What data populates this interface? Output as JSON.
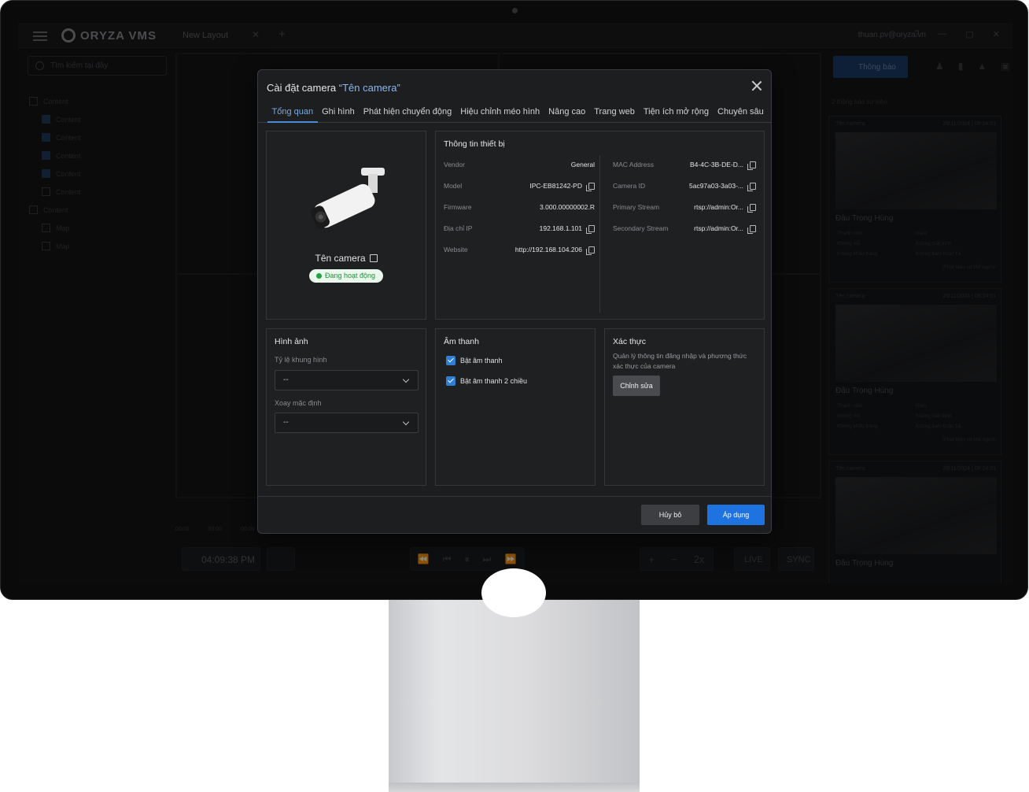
{
  "app": {
    "logo_text": "ORYZA VMS",
    "layout_tab": "New Layout",
    "user_email": "thuan.pv@oryza.vn",
    "search_placeholder": "Tìm kiếm tại đây",
    "tree": [
      {
        "label": "Content",
        "level": 0
      },
      {
        "label": "Content",
        "level": 1,
        "checked": true
      },
      {
        "label": "Content",
        "level": 1,
        "checked": true
      },
      {
        "label": "Content",
        "level": 1,
        "checked": true
      },
      {
        "label": "Content",
        "level": 1,
        "checked": true
      },
      {
        "label": "Content",
        "level": 1,
        "checked": false
      },
      {
        "label": "Content",
        "level": 0
      },
      {
        "label": "Map",
        "level": 1,
        "checked": false
      },
      {
        "label": "Map",
        "level": 1,
        "checked": false
      }
    ],
    "notifications": {
      "button": "Thông báo",
      "event_count": "2 thông báo sự kiện",
      "cards": [
        {
          "camera": "Tên camera",
          "time": "28/11/2024 | 08:24:01",
          "person": "Đậu Trọng Hùng",
          "attrs": [
            "Thanh niên",
            "Nam",
            "Không mũ",
            "Không mắt kính",
            "Không khẩu trang",
            "Không balo hoặc túi"
          ],
          "footer": "Phát hiện cơ thể người"
        },
        {
          "camera": "Tên camera",
          "time": "28/11/2024 | 08:24:01",
          "person": "Đậu Trọng Hùng",
          "attrs": [
            "Thanh niên",
            "Nam",
            "Không mũ",
            "Không mắt kính",
            "Không khẩu trang",
            "Không balo hoặc túi"
          ],
          "footer": "Phát hiện cơ thể người"
        },
        {
          "camera": "Tên camera",
          "time": "28/11/2024 | 08:24:01",
          "person": "Đậu Trọng Hùng",
          "attrs": [],
          "footer": ""
        }
      ]
    },
    "timeline": {
      "clock": "04:09:38 PM",
      "ruler": [
        "00:00",
        "00:00",
        "00:00"
      ],
      "live": "LIVE",
      "sync": "SYNC",
      "speed": "2x"
    }
  },
  "dialog": {
    "title_prefix": "Cài đặt camera ",
    "title_highlight": "“Tên camera”",
    "tabs": [
      "Tổng quan",
      "Ghi hình",
      "Phát hiện chuyển động",
      "Hiệu chỉnh méo hình",
      "Nâng cao",
      "Trang web",
      "Tiện ích mở rộng",
      "Chuyên sâu"
    ],
    "active_tab": 0,
    "camera_name": "Tên camera",
    "status": "Đang hoạt động",
    "info_title": "Thông tin thiết bị",
    "info_left": [
      {
        "label": "Vendor",
        "value": "General",
        "copy": false
      },
      {
        "label": "Model",
        "value": "IPC-EB81242-PD",
        "copy": true
      },
      {
        "label": "Firmware",
        "value": "3.000.00000002.R",
        "copy": false
      },
      {
        "label": "Địa chỉ IP",
        "value": "192.168.1.101",
        "copy": true
      },
      {
        "label": "Website",
        "value": "http://192.168.104.206",
        "copy": true
      }
    ],
    "info_right": [
      {
        "label": "MAC Address",
        "value": "B4-4C-3B-DE-D...",
        "copy": true
      },
      {
        "label": "Camera ID",
        "value": "5ac97a03-3a03-...",
        "copy": true
      },
      {
        "label": "Primary Stream",
        "value": "rtsp://admin:Or...",
        "copy": true
      },
      {
        "label": "Secondary Stream",
        "value": "rtsp://admin:Or...",
        "copy": true
      }
    ],
    "image": {
      "title": "Hình ảnh",
      "aspect_label": "Tỷ lệ khung hình",
      "aspect_value": "--",
      "rotate_label": "Xoay mặc định",
      "rotate_value": "--"
    },
    "audio": {
      "title": "Âm thanh",
      "enable_audio": "Bật âm thanh",
      "enable_two_way": "Bật âm thanh 2 chiều"
    },
    "auth": {
      "title": "Xác thực",
      "description": "Quản lý thông tin đăng nhập và phương thức xác thực của camera",
      "edit_button": "Chỉnh sửa"
    },
    "cancel_button": "Hủy bỏ",
    "apply_button": "Áp dụng"
  }
}
